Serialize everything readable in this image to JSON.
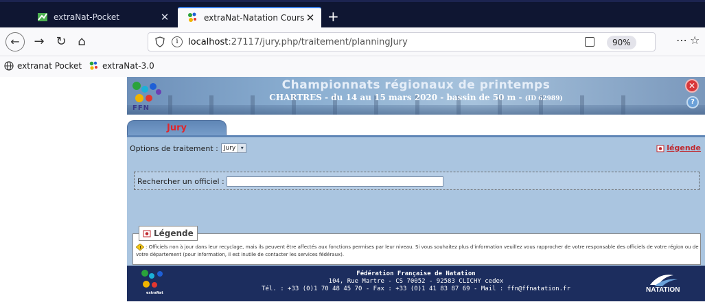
{
  "browser": {
    "tabs": [
      {
        "label": "extraNat-Pocket",
        "active": false
      },
      {
        "label": "extraNat-Natation Course",
        "active": true
      }
    ],
    "url_host": "localhost",
    "url_rest": ":27117/jury.php/traitement/planningJury",
    "zoom": "90%",
    "bookmarks": [
      "extranat Pocket",
      "extraNat-3.0"
    ]
  },
  "banner": {
    "title": "Championnats régionaux de printemps",
    "subtitle": "CHARTRES - du 14 au 15 mars 2020 - bassin de 50 m -",
    "id_label": "(ID 62989)",
    "logo_text": "FFN"
  },
  "tab": {
    "label": "Jury"
  },
  "options": {
    "label": "Options de traitement :",
    "selected": "Jury",
    "legend_link": "légende"
  },
  "search": {
    "label": "Rechercher un officiel :",
    "value": ""
  },
  "legend": {
    "title": "Légende",
    "text": ": Officiels non à jour dans leur recyclage, mais ils peuvent être affectés aux fonctions permises par leur niveau. Si vous souhaitez plus d'information veuillez vous rapprocher de votre responsable des officiels de votre région ou de votre département (pour information, il est inutile de contacter les services fédéraux)."
  },
  "footer": {
    "org": "Fédération Française de Natation",
    "address": "104, Rue Martre - CS 70052 - 92583 CLICHY cedex",
    "contact": "Tél. : +33 (0)1 70 48 45 70 - Fax : +33 (0)1 41 83 87 69 - Mail : ffn@ffnatation.fr",
    "left_logo": "extraNat",
    "right_logo": "NATATION"
  }
}
